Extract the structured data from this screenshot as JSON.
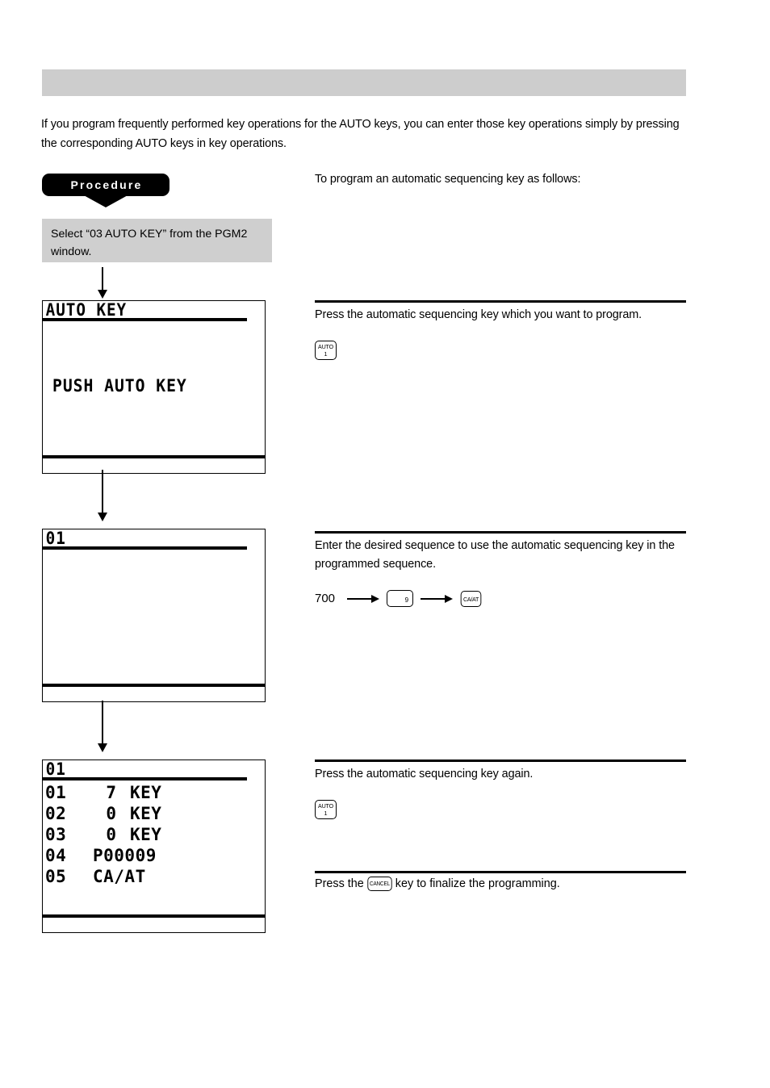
{
  "header": {
    "bar_label": ""
  },
  "intro": {
    "paragraph": "If you program frequently performed key operations for the AUTO keys, you can enter those key operations simply by pressing the corresponding AUTO keys in key operations."
  },
  "procedure": {
    "badge_label": "Procedure",
    "intro_text": "To program an automatic sequencing key as follows:"
  },
  "steps": {
    "step0_instruction": "Select “03 AUTO KEY” from the PGM2 window."
  },
  "lcd_panels": [
    {
      "title": "AUTO KEY",
      "center_message": "PUSH AUTO KEY",
      "rows": []
    },
    {
      "title": "01",
      "center_message": "",
      "rows": []
    },
    {
      "title": "01",
      "center_message": "",
      "rows": [
        {
          "index": "01",
          "arg": "7",
          "label": "KEY"
        },
        {
          "index": "02",
          "arg": "0",
          "label": "KEY"
        },
        {
          "index": "03",
          "arg": "0",
          "label": "KEY"
        },
        {
          "index": "04",
          "arg": "P00009",
          "label": ""
        },
        {
          "index": "05",
          "arg": "CA/AT",
          "label": ""
        }
      ]
    }
  ],
  "right_sections": [
    {
      "text": "Press the automatic sequencing key which you want to program.",
      "key_auto_line1": "AUTO",
      "key_auto_line2": "1"
    },
    {
      "text": "Enter the desired sequence to use the automatic sequencing key in the programmed sequence.",
      "seq_number": "700",
      "seq_key_digit": "9",
      "seq_key_caat": "CA/AT"
    },
    {
      "text": "Press the automatic sequencing key again.",
      "key_auto_line1": "AUTO",
      "key_auto_line2": "1"
    },
    {
      "text_before": "Press the",
      "key_cancel": "CANCEL",
      "text_after": "key to finalize the programming."
    }
  ],
  "colors": {
    "header_bar": "#cdcdcd",
    "step_box": "#cfcfcf",
    "badge": "#000000",
    "ink": "#000000",
    "page": "#ffffff"
  },
  "icons": {
    "down_arrow": "arrow-down-icon",
    "right_arrow": "arrow-right-icon"
  }
}
